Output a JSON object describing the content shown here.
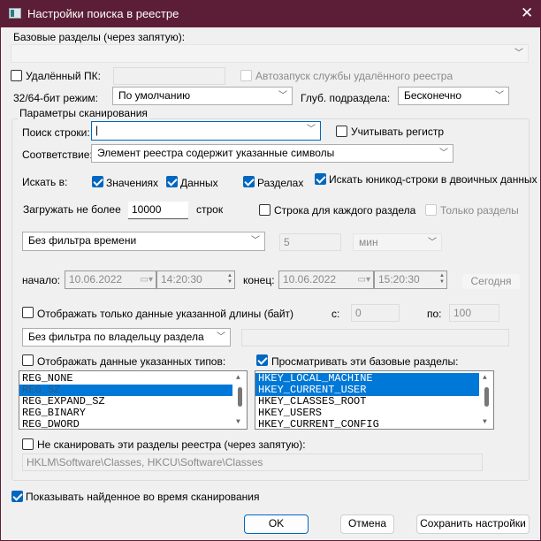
{
  "window": {
    "title": "Настройки поиска в реестре"
  },
  "base_keys": {
    "label": "Базовые разделы (через запятую):",
    "value": ""
  },
  "remote": {
    "label": "Удалённый ПК:",
    "checked": false,
    "value": "",
    "autostart_label": "Автозапуск службы удалённого реестра"
  },
  "bitmode": {
    "label": "32/64-бит режим:",
    "value": "По умолчанию"
  },
  "depth": {
    "label": "Глуб. подраздела:",
    "value": "Бесконечно"
  },
  "scan": {
    "group_label": "Параметры сканирования",
    "search_label": "Поиск строки:",
    "search_value": "",
    "case_label": "Учитывать регистр",
    "match_label": "Соответствие:",
    "match_value": "Элемент реестра содержит указанные символы",
    "look_in_label": "Искать в:",
    "values_label": "Значениях",
    "data_label": "Данных",
    "keys_label": "Разделах",
    "unicode_label": "Искать юникод-строки в двоичных данных",
    "load_label": "Загружать не более",
    "load_value": "10000",
    "rows_label": "строк",
    "row_per_key_label": "Строка для каждого раздела",
    "only_keys_label": "Только разделы",
    "time_filter": "Без фильтра времени",
    "time_amount": "5",
    "time_unit": "мин",
    "start_label": "начало:",
    "start_date": "10.06.2022",
    "start_time": "14:20:30",
    "end_label": "конец:",
    "end_date": "10.06.2022",
    "end_time": "15:20:30",
    "today_label": "Сегодня",
    "length_label": "Отображать только данные указанной длины (байт)",
    "from_label": "с:",
    "from_value": "0",
    "to_label": "по:",
    "to_value": "100",
    "owner_filter": "Без фильтра по владельцу раздела",
    "owner_value": "",
    "types_label": "Отображать данные указанных типов:",
    "types": [
      "REG_NONE",
      "REG_SZ",
      "REG_EXPAND_SZ",
      "REG_BINARY",
      "REG_DWORD"
    ],
    "roots_label": "Просматривать эти базовые разделы:",
    "roots": [
      "HKEY_LOCAL_MACHINE",
      "HKEY_CURRENT_USER",
      "HKEY_CLASSES_ROOT",
      "HKEY_USERS",
      "HKEY_CURRENT_CONFIG"
    ],
    "exclude_label": "Не сканировать эти разделы реестра (через запятую):",
    "exclude_value": "HKLM\\Software\\Classes, HKCU\\Software\\Classes"
  },
  "show_found_label": "Показывать найденное во время сканирования",
  "buttons": {
    "ok": "OK",
    "cancel": "Отмена",
    "save": "Сохранить настройки"
  }
}
